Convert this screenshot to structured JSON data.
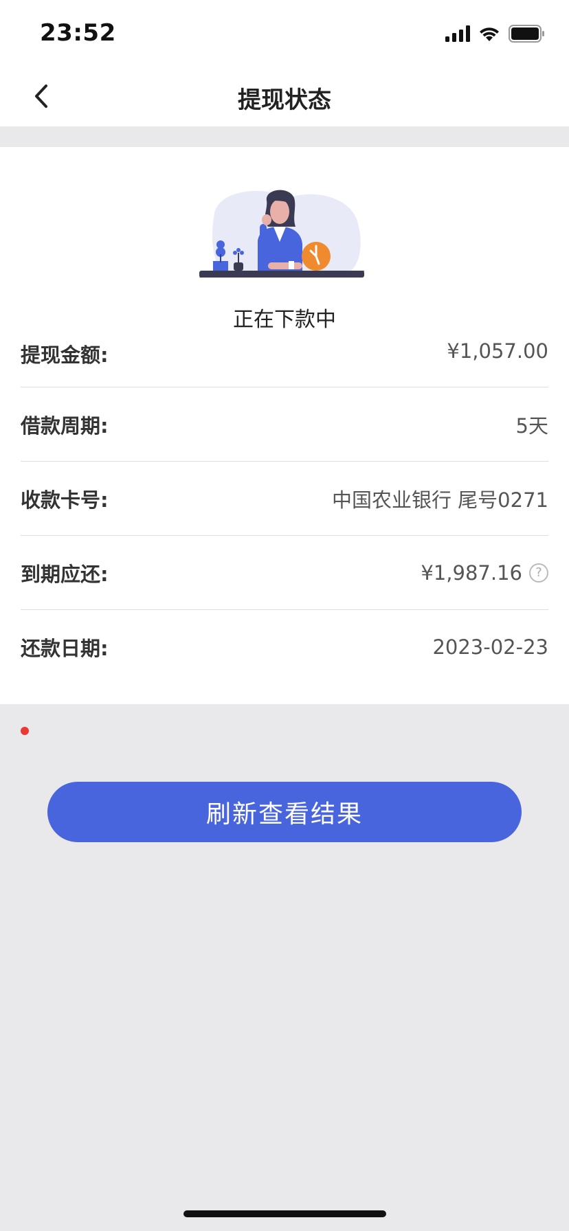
{
  "status_bar": {
    "time": "23:52",
    "icons": [
      "signal-icon",
      "wifi-icon",
      "battery-icon"
    ]
  },
  "nav": {
    "title": "提现状态",
    "back_icon": "chevron-left-icon"
  },
  "status": {
    "text": "正在下款中"
  },
  "details": [
    {
      "label": "提现金额:",
      "value": "¥1,057.00"
    },
    {
      "label": "借款周期:",
      "value": "5天"
    },
    {
      "label": "收款卡号:",
      "value": "中国农业银行 尾号0271"
    },
    {
      "label": "到期应还:",
      "value": "¥1,987.16",
      "help_icon": "?"
    },
    {
      "label": "还款日期:",
      "value": "2023-02-23"
    }
  ],
  "actions": {
    "refresh_label": "刷新查看结果"
  },
  "colors": {
    "accent": "#4965dd",
    "background": "#e9e9eb",
    "dot": "#e83a32"
  }
}
